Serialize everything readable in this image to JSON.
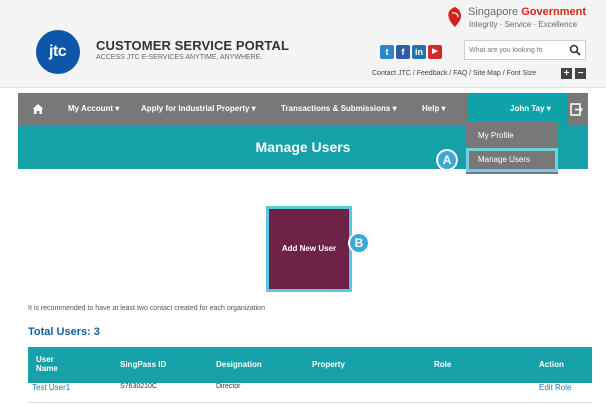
{
  "header": {
    "logo_text": "jtc",
    "portal_title": "CUSTOMER SERVICE PORTAL",
    "portal_subtitle": "ACCESS JTC E-SERVICES ANYTIME, ANYWHERE.",
    "gov_name_prefix": "Singapore",
    "gov_name_suffix": "Government",
    "gov_tagline": "Integrity · Service · Excellence",
    "social": [
      {
        "icon": "twitter-icon",
        "glyph": "t",
        "color": "#2e86c9"
      },
      {
        "icon": "facebook-icon",
        "glyph": "f",
        "color": "#2f5ba6"
      },
      {
        "icon": "linkedin-icon",
        "glyph": "in",
        "color": "#1f74b0"
      },
      {
        "icon": "youtube-icon",
        "glyph": "▶",
        "color": "#d22b2b"
      }
    ],
    "search_placeholder": "What are you looking fo",
    "utility_links": "Contact JTC / Feedback / FAQ / Site Map / Font Size",
    "font_increase": "+",
    "font_decrease": "−"
  },
  "nav": {
    "home_icon": "home-icon",
    "items": [
      {
        "label": "My Account ▾"
      },
      {
        "label": "Apply for Industrial Property ▾"
      },
      {
        "label": "Transactions & Submissions ▾"
      },
      {
        "label": "Help ▾"
      }
    ],
    "user_label": "John Tay ▾",
    "logout_icon": "logout-icon"
  },
  "dropdown": {
    "items": [
      {
        "label": "My Profile"
      },
      {
        "label": "Manage Users"
      }
    ]
  },
  "page": {
    "title": "Manage Users",
    "add_button_label": "Add New User",
    "note": "It is recommended to have at least two contact created for each organization",
    "total_users": "Total Users: 3"
  },
  "markers": {
    "a": "A",
    "b": "B"
  },
  "table": {
    "headers": {
      "user_name": "User\nName",
      "singpass_id": "SingPass ID",
      "designation": "Designation",
      "property": "Property",
      "role": "Role",
      "action": "Action"
    },
    "rows": [
      {
        "user_name": "Test User1",
        "singpass_id": "S7630210C",
        "designation": "Director",
        "property": "",
        "role": "",
        "action": "Edit Role"
      }
    ]
  },
  "colors": {
    "teal": "#16a0a8",
    "nav_gray": "#787878",
    "add_button": "#6e2247",
    "highlight": "#5fc4e0",
    "link_blue": "#2277c4",
    "gov_red": "#d4231a"
  }
}
